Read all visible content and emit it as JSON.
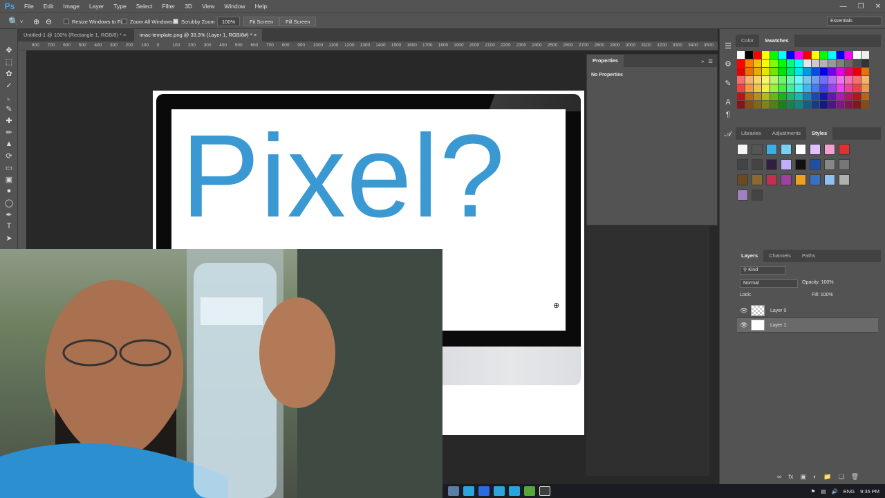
{
  "app": {
    "logo": "Ps"
  },
  "menu": [
    "File",
    "Edit",
    "Image",
    "Layer",
    "Type",
    "Select",
    "Filter",
    "3D",
    "View",
    "Window",
    "Help"
  ],
  "options": {
    "resize_windows": "Resize Windows to Fit",
    "zoom_all": "Zoom All Windows",
    "scrubby": "Scrubby Zoom",
    "zoom_value": "100%",
    "fit_screen": "Fit Screen",
    "fill_screen": "Fill Screen",
    "workspace": "Essentials"
  },
  "tabs": [
    {
      "label": "Untitled-1 @ 100% (Rectangle 1, RGB/8) *",
      "close": "×"
    },
    {
      "label": "imac-template.png @ 33.3% (Layer 1, RGB/8#) *",
      "close": "×"
    }
  ],
  "ruler_ticks": [
    "800",
    "700",
    "600",
    "500",
    "400",
    "300",
    "200",
    "100",
    "0",
    "100",
    "200",
    "300",
    "400",
    "500",
    "600",
    "700",
    "800",
    "900",
    "1000",
    "1100",
    "1200",
    "1300",
    "1400",
    "1500",
    "1600",
    "1700",
    "1800",
    "1900",
    "2000",
    "2100",
    "2200",
    "2300",
    "2400",
    "2500",
    "2600",
    "2700",
    "2800",
    "2900",
    "3000",
    "3100",
    "3200",
    "3300",
    "3400",
    "3500"
  ],
  "canvas": {
    "headline": "Pixel?"
  },
  "properties": {
    "tab": "Properties",
    "empty_text": "No Properties"
  },
  "swatches_panel": {
    "tabs": [
      "Color",
      "Swatches"
    ]
  },
  "styles_panel": {
    "tabs": [
      "Libraries",
      "Adjustments",
      "Styles"
    ]
  },
  "layers_panel": {
    "tabs": [
      "Layers",
      "Channels",
      "Paths"
    ],
    "filter": "Kind",
    "blend_mode": "Normal",
    "opacity_label": "Opacity:",
    "opacity_value": "100%",
    "lock_label": "Lock:",
    "fill_label": "Fill:",
    "fill_value": "100%",
    "layers": [
      {
        "name": "Layer 0"
      },
      {
        "name": "Layer 1"
      }
    ]
  },
  "taskbar": {
    "lang": "ENG",
    "time": "9:35 PM"
  },
  "colors": {
    "accent_text": "#3a99d3",
    "panel_bg": "#535353",
    "workspace_bg": "#282828"
  },
  "swatches": [
    "#ffffff",
    "#000000",
    "#ff0000",
    "#ffff00",
    "#00ff00",
    "#00ffff",
    "#0000ff",
    "#ff00ff",
    "#ff0000",
    "#ffff00",
    "#00ff00",
    "#00ffff",
    "#0000ff",
    "#ff00ff",
    "#ffffff",
    "#eeeeee",
    "#dddddd",
    "#cccccc",
    "#bbbbbb",
    "#aaaaaa",
    "#999999",
    "#888888",
    "#777777",
    "#666666",
    "#555555",
    "#444444",
    "#333333",
    "#222222",
    "#111111",
    "#ff8080"
  ]
}
